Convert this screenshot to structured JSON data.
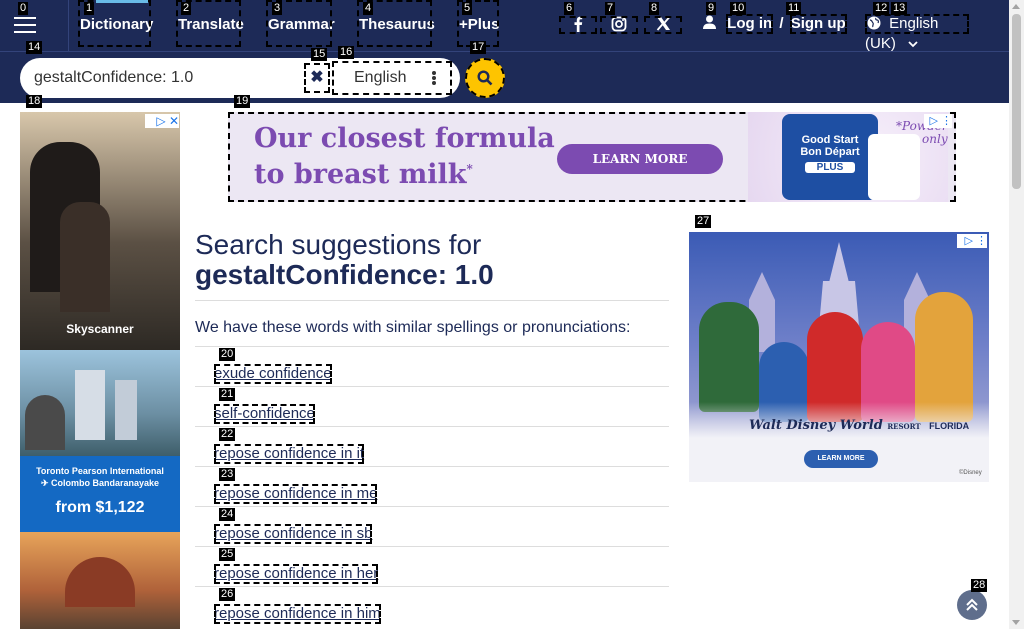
{
  "header": {
    "nav": [
      {
        "label": "Dictionary"
      },
      {
        "label": "Translate"
      },
      {
        "label": "Grammar"
      },
      {
        "label": "Thesaurus"
      },
      {
        "label": "+Plus"
      }
    ],
    "social": [
      "facebook-icon",
      "instagram-icon",
      "x-icon"
    ],
    "login_label": "Log in",
    "separator": "/",
    "signup_label": "Sign up",
    "language": "English (UK)"
  },
  "search": {
    "value": "gestaltConfidence: 1.0",
    "dictionary": "English"
  },
  "tags": [
    "0",
    "1",
    "2",
    "3",
    "4",
    "5",
    "6",
    "7",
    "8",
    "9",
    "10",
    "11",
    "12",
    "13",
    "14",
    "15",
    "16",
    "17",
    "18",
    "19",
    "20",
    "21",
    "22",
    "23",
    "24",
    "25",
    "26",
    "27",
    "28"
  ],
  "ads": {
    "banner": {
      "line1": "Our closest formula",
      "line2": "to breast milk",
      "sup": "*",
      "cta": "LEARN MORE",
      "brand_top": "Good Start",
      "brand_mid": "Bon Départ",
      "brand_plus": "PLUS",
      "powder": "*Powder",
      "only": "only"
    },
    "left": {
      "brand": "Skyscanner",
      "route1": "Toronto Pearson International",
      "route2": "✈ Colombo Bandaranayake",
      "price": "from $1,122"
    },
    "right": {
      "brand": "Walt Disney World",
      "resort": "RESORT",
      "location": "FLORIDA",
      "cta": "LEARN MORE",
      "copyright": "©Disney"
    }
  },
  "main": {
    "title_line1": "Search suggestions for",
    "title_line2": "gestaltConfidence: 1.0",
    "intro": "We have these words with similar spellings or pronunciations:",
    "suggestions": [
      "exude confidence",
      "self-confidence",
      "repose confidence in it",
      "repose confidence in me",
      "repose confidence in sb",
      "repose confidence in her",
      "repose confidence in him"
    ]
  }
}
